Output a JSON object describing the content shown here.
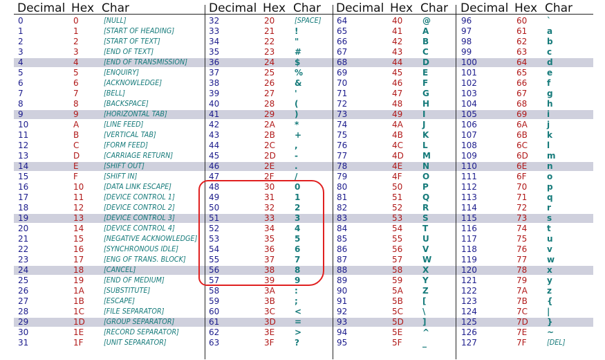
{
  "headers": {
    "decimal": "Decimal",
    "hex": "Hex",
    "char": "Char"
  },
  "columns": [
    [
      {
        "dec": "0",
        "hex": "0",
        "chr": "[NULL]",
        "ctrl": true
      },
      {
        "dec": "1",
        "hex": "1",
        "chr": "[START OF HEADING]",
        "ctrl": true
      },
      {
        "dec": "2",
        "hex": "2",
        "chr": "[START OF TEXT]",
        "ctrl": true
      },
      {
        "dec": "3",
        "hex": "3",
        "chr": "[END OF TEXT]",
        "ctrl": true
      },
      {
        "dec": "4",
        "hex": "4",
        "chr": "[END OF TRANSMISSION]",
        "ctrl": true
      },
      {
        "dec": "5",
        "hex": "5",
        "chr": "[ENQUIRY]",
        "ctrl": true
      },
      {
        "dec": "6",
        "hex": "6",
        "chr": "[ACKNOWLEDGE]",
        "ctrl": true
      },
      {
        "dec": "7",
        "hex": "7",
        "chr": "[BELL]",
        "ctrl": true
      },
      {
        "dec": "8",
        "hex": "8",
        "chr": "[BACKSPACE]",
        "ctrl": true
      },
      {
        "dec": "9",
        "hex": "9",
        "chr": "[HORIZONTAL TAB]",
        "ctrl": true
      },
      {
        "dec": "10",
        "hex": "A",
        "chr": "[LINE FEED]",
        "ctrl": true
      },
      {
        "dec": "11",
        "hex": "B",
        "chr": "[VERTICAL TAB]",
        "ctrl": true
      },
      {
        "dec": "12",
        "hex": "C",
        "chr": "[FORM FEED]",
        "ctrl": true
      },
      {
        "dec": "13",
        "hex": "D",
        "chr": "[CARRIAGE RETURN]",
        "ctrl": true
      },
      {
        "dec": "14",
        "hex": "E",
        "chr": "[SHIFT OUT]",
        "ctrl": true
      },
      {
        "dec": "15",
        "hex": "F",
        "chr": "[SHIFT IN]",
        "ctrl": true
      },
      {
        "dec": "16",
        "hex": "10",
        "chr": "[DATA LINK ESCAPE]",
        "ctrl": true
      },
      {
        "dec": "17",
        "hex": "11",
        "chr": "[DEVICE CONTROL 1]",
        "ctrl": true
      },
      {
        "dec": "18",
        "hex": "12",
        "chr": "[DEVICE CONTROL 2]",
        "ctrl": true
      },
      {
        "dec": "19",
        "hex": "13",
        "chr": "[DEVICE CONTROL 3]",
        "ctrl": true
      },
      {
        "dec": "20",
        "hex": "14",
        "chr": "[DEVICE CONTROL 4]",
        "ctrl": true
      },
      {
        "dec": "21",
        "hex": "15",
        "chr": "[NEGATIVE ACKNOWLEDGE]",
        "ctrl": true
      },
      {
        "dec": "22",
        "hex": "16",
        "chr": "[SYNCHRONOUS IDLE]",
        "ctrl": true
      },
      {
        "dec": "23",
        "hex": "17",
        "chr": "[ENG OF TRANS. BLOCK]",
        "ctrl": true
      },
      {
        "dec": "24",
        "hex": "18",
        "chr": "[CANCEL]",
        "ctrl": true
      },
      {
        "dec": "25",
        "hex": "19",
        "chr": "[END OF MEDIUM]",
        "ctrl": true
      },
      {
        "dec": "26",
        "hex": "1A",
        "chr": "[SUBSTITUTE]",
        "ctrl": true
      },
      {
        "dec": "27",
        "hex": "1B",
        "chr": "[ESCAPE]",
        "ctrl": true
      },
      {
        "dec": "28",
        "hex": "1C",
        "chr": "[FILE SEPARATOR]",
        "ctrl": true
      },
      {
        "dec": "29",
        "hex": "1D",
        "chr": "[GROUP SEPARATOR]",
        "ctrl": true
      },
      {
        "dec": "30",
        "hex": "1E",
        "chr": "[RECORD SEPARATOR]",
        "ctrl": true
      },
      {
        "dec": "31",
        "hex": "1F",
        "chr": "[UNIT SEPARATOR]",
        "ctrl": true
      }
    ],
    [
      {
        "dec": "32",
        "hex": "20",
        "chr": "[SPACE]",
        "ctrl": true
      },
      {
        "dec": "33",
        "hex": "21",
        "chr": "!"
      },
      {
        "dec": "34",
        "hex": "22",
        "chr": "\""
      },
      {
        "dec": "35",
        "hex": "23",
        "chr": "#"
      },
      {
        "dec": "36",
        "hex": "24",
        "chr": "$"
      },
      {
        "dec": "37",
        "hex": "25",
        "chr": "%"
      },
      {
        "dec": "38",
        "hex": "26",
        "chr": "&"
      },
      {
        "dec": "39",
        "hex": "27",
        "chr": "'"
      },
      {
        "dec": "40",
        "hex": "28",
        "chr": "("
      },
      {
        "dec": "41",
        "hex": "29",
        "chr": ")"
      },
      {
        "dec": "42",
        "hex": "2A",
        "chr": "*"
      },
      {
        "dec": "43",
        "hex": "2B",
        "chr": "+"
      },
      {
        "dec": "44",
        "hex": "2C",
        "chr": ","
      },
      {
        "dec": "45",
        "hex": "2D",
        "chr": "-"
      },
      {
        "dec": "46",
        "hex": "2E",
        "chr": "."
      },
      {
        "dec": "47",
        "hex": "2F",
        "chr": "/"
      },
      {
        "dec": "48",
        "hex": "30",
        "chr": "0"
      },
      {
        "dec": "49",
        "hex": "31",
        "chr": "1"
      },
      {
        "dec": "50",
        "hex": "32",
        "chr": "2"
      },
      {
        "dec": "51",
        "hex": "33",
        "chr": "3"
      },
      {
        "dec": "52",
        "hex": "34",
        "chr": "4"
      },
      {
        "dec": "53",
        "hex": "35",
        "chr": "5"
      },
      {
        "dec": "54",
        "hex": "36",
        "chr": "6"
      },
      {
        "dec": "55",
        "hex": "37",
        "chr": "7"
      },
      {
        "dec": "56",
        "hex": "38",
        "chr": "8"
      },
      {
        "dec": "57",
        "hex": "39",
        "chr": "9"
      },
      {
        "dec": "58",
        "hex": "3A",
        "chr": ":"
      },
      {
        "dec": "59",
        "hex": "3B",
        "chr": ";"
      },
      {
        "dec": "60",
        "hex": "3C",
        "chr": "<"
      },
      {
        "dec": "61",
        "hex": "3D",
        "chr": "="
      },
      {
        "dec": "62",
        "hex": "3E",
        "chr": ">"
      },
      {
        "dec": "63",
        "hex": "3F",
        "chr": "?"
      }
    ],
    [
      {
        "dec": "64",
        "hex": "40",
        "chr": "@"
      },
      {
        "dec": "65",
        "hex": "41",
        "chr": "A"
      },
      {
        "dec": "66",
        "hex": "42",
        "chr": "B"
      },
      {
        "dec": "67",
        "hex": "43",
        "chr": "C"
      },
      {
        "dec": "68",
        "hex": "44",
        "chr": "D"
      },
      {
        "dec": "69",
        "hex": "45",
        "chr": "E"
      },
      {
        "dec": "70",
        "hex": "46",
        "chr": "F"
      },
      {
        "dec": "71",
        "hex": "47",
        "chr": "G"
      },
      {
        "dec": "72",
        "hex": "48",
        "chr": "H"
      },
      {
        "dec": "73",
        "hex": "49",
        "chr": "I"
      },
      {
        "dec": "74",
        "hex": "4A",
        "chr": "J"
      },
      {
        "dec": "75",
        "hex": "4B",
        "chr": "K"
      },
      {
        "dec": "76",
        "hex": "4C",
        "chr": "L"
      },
      {
        "dec": "77",
        "hex": "4D",
        "chr": "M"
      },
      {
        "dec": "78",
        "hex": "4E",
        "chr": "N"
      },
      {
        "dec": "79",
        "hex": "4F",
        "chr": "O"
      },
      {
        "dec": "80",
        "hex": "50",
        "chr": "P"
      },
      {
        "dec": "81",
        "hex": "51",
        "chr": "Q"
      },
      {
        "dec": "82",
        "hex": "52",
        "chr": "R"
      },
      {
        "dec": "83",
        "hex": "53",
        "chr": "S"
      },
      {
        "dec": "84",
        "hex": "54",
        "chr": "T"
      },
      {
        "dec": "85",
        "hex": "55",
        "chr": "U"
      },
      {
        "dec": "86",
        "hex": "56",
        "chr": "V"
      },
      {
        "dec": "87",
        "hex": "57",
        "chr": "W"
      },
      {
        "dec": "88",
        "hex": "58",
        "chr": "X"
      },
      {
        "dec": "89",
        "hex": "59",
        "chr": "Y"
      },
      {
        "dec": "90",
        "hex": "5A",
        "chr": "Z"
      },
      {
        "dec": "91",
        "hex": "5B",
        "chr": "["
      },
      {
        "dec": "92",
        "hex": "5C",
        "chr": "\\"
      },
      {
        "dec": "93",
        "hex": "5D",
        "chr": "]"
      },
      {
        "dec": "94",
        "hex": "5E",
        "chr": "^"
      },
      {
        "dec": "95",
        "hex": "5F",
        "chr": "_"
      }
    ],
    [
      {
        "dec": "96",
        "hex": "60",
        "chr": "`"
      },
      {
        "dec": "97",
        "hex": "61",
        "chr": "a"
      },
      {
        "dec": "98",
        "hex": "62",
        "chr": "b"
      },
      {
        "dec": "99",
        "hex": "63",
        "chr": "c"
      },
      {
        "dec": "100",
        "hex": "64",
        "chr": "d"
      },
      {
        "dec": "101",
        "hex": "65",
        "chr": "e"
      },
      {
        "dec": "102",
        "hex": "66",
        "chr": "f"
      },
      {
        "dec": "103",
        "hex": "67",
        "chr": "g"
      },
      {
        "dec": "104",
        "hex": "68",
        "chr": "h"
      },
      {
        "dec": "105",
        "hex": "69",
        "chr": "i"
      },
      {
        "dec": "106",
        "hex": "6A",
        "chr": "j"
      },
      {
        "dec": "107",
        "hex": "6B",
        "chr": "k"
      },
      {
        "dec": "108",
        "hex": "6C",
        "chr": "l"
      },
      {
        "dec": "109",
        "hex": "6D",
        "chr": "m"
      },
      {
        "dec": "110",
        "hex": "6E",
        "chr": "n"
      },
      {
        "dec": "111",
        "hex": "6F",
        "chr": "o"
      },
      {
        "dec": "112",
        "hex": "70",
        "chr": "p"
      },
      {
        "dec": "113",
        "hex": "71",
        "chr": "q"
      },
      {
        "dec": "114",
        "hex": "72",
        "chr": "r"
      },
      {
        "dec": "115",
        "hex": "73",
        "chr": "s"
      },
      {
        "dec": "116",
        "hex": "74",
        "chr": "t"
      },
      {
        "dec": "117",
        "hex": "75",
        "chr": "u"
      },
      {
        "dec": "118",
        "hex": "76",
        "chr": "v"
      },
      {
        "dec": "119",
        "hex": "77",
        "chr": "w"
      },
      {
        "dec": "120",
        "hex": "78",
        "chr": "x"
      },
      {
        "dec": "121",
        "hex": "79",
        "chr": "y"
      },
      {
        "dec": "122",
        "hex": "7A",
        "chr": "z"
      },
      {
        "dec": "123",
        "hex": "7B",
        "chr": "{"
      },
      {
        "dec": "124",
        "hex": "7C",
        "chr": "|"
      },
      {
        "dec": "125",
        "hex": "7D",
        "chr": "}"
      },
      {
        "dec": "126",
        "hex": "7E",
        "chr": "~"
      },
      {
        "dec": "127",
        "hex": "7F",
        "chr": "[DEL]",
        "ctrl": true
      }
    ]
  ],
  "highlighted_rows": [
    4,
    9,
    14,
    19,
    24,
    29
  ],
  "colors": {
    "decimal": "#1c1c8c",
    "hex": "#b01818",
    "char": "#157a7a",
    "row_highlight": "#cfd0dd",
    "annotation": "#e02020"
  }
}
